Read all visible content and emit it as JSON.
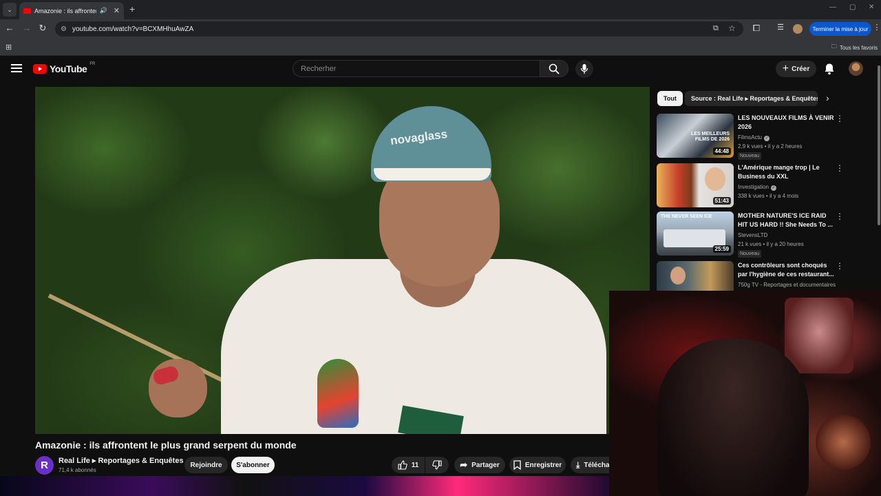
{
  "browser": {
    "tab_title": "Amazonie : ils affrontent le",
    "tab_speaker": "🔊",
    "tab_close": "✕",
    "new_tab": "+",
    "url": "youtube.com/watch?v=BCXMHhuAwZA",
    "update_button": "Terminer la mise à jour",
    "bookmarks_all": "Tous les favoris",
    "win_min": "—",
    "win_max": "▢",
    "win_close": "✕"
  },
  "header": {
    "logo_text": "YouTube",
    "logo_country": "FR",
    "search_placeholder": "Recherher",
    "create_label": "Créer"
  },
  "video": {
    "cap_logo": "novaglass",
    "title": "Amazonie : ils affrontent le plus grand serpent du monde",
    "channel_initial": "R",
    "channel_name": "Real Life ▸ Reportages & Enquêtes",
    "subscribers": "71,4 k abonnés",
    "join_label": "Rejoindre",
    "subscribe_label": "S'abonner",
    "likes": "11",
    "share_label": "Partager",
    "save_label": "Enregistrer",
    "download_label": "Télécha"
  },
  "chips": [
    {
      "label": "Tout",
      "active": true
    },
    {
      "label": "Source : Real Life ▸ Reportages & Enquêtes",
      "active": false
    }
  ],
  "recommendations": [
    {
      "title": "LES NOUVEAUX FILMS À VENIR 2026",
      "channel": "FilmsActu",
      "verified": true,
      "meta": "2,9 k vues • il y a 2 heures",
      "badge": "Nouveau",
      "duration": "44:48",
      "thumb_text": "LES MEILLEURS FILMS DE 2026"
    },
    {
      "title": "L'Amérique mange trop | Le Business du XXL",
      "channel": "Investigation",
      "verified": true,
      "meta": "338 k vues • il y a 4 mois",
      "badge": "",
      "duration": "51:43",
      "thumb_text": ""
    },
    {
      "title": "MOTHER NATURE'S ICE RAID HIT US HARD !! She Needs To ...",
      "channel": "StevensLTD",
      "verified": false,
      "meta": "21 k vues • il y a 20 heures",
      "badge": "Nouveau",
      "duration": "25:59",
      "thumb_text": "THE NEVER SEEN ICE"
    },
    {
      "title": "Ces contrôleurs sont choqués par l'hygiène de ces restaurant...",
      "channel": "750g TV - Reportages et documentaires",
      "verified": false,
      "meta": "",
      "badge": "",
      "duration": "",
      "thumb_text": ""
    }
  ],
  "colors": {
    "accent": "#ff0000",
    "update_blue": "#0b57d0",
    "bg": "#0f0f0f"
  }
}
